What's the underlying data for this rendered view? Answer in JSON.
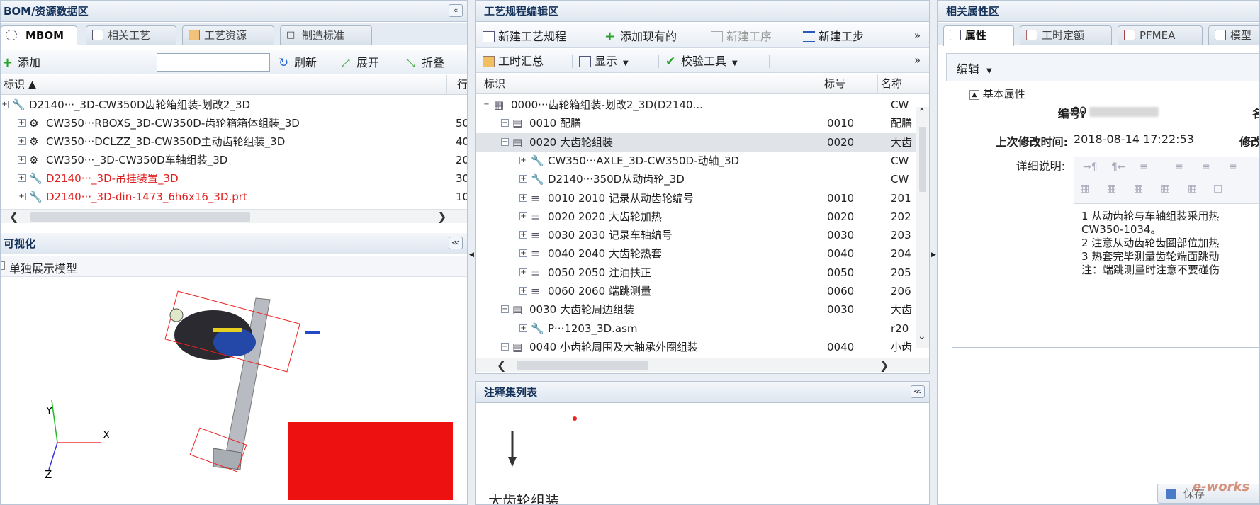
{
  "left": {
    "title": "BOM/资源数据区",
    "tabs": [
      "MBOM",
      "相关工艺",
      "工艺资源",
      "制造标准"
    ],
    "toolbar": {
      "add": "添加",
      "refresh": "刷新",
      "expand": "展开",
      "collapse": "折叠",
      "search_value": ""
    },
    "columns": [
      "标识",
      "行"
    ],
    "rows": [
      {
        "label": "D2140···_3D-CW350D齿轮箱组装-划改2_3D",
        "num": "",
        "red": false
      },
      {
        "label": "CW350···RBOXS_3D-CW350D-齿轮箱箱体组装_3D",
        "num": "50",
        "red": false
      },
      {
        "label": "CW350···DCLZZ_3D-CW350D主动齿轮组装_3D",
        "num": "40",
        "red": false
      },
      {
        "label": "CW350···_3D-CW350D车轴组装_3D",
        "num": "20",
        "red": false
      },
      {
        "label": "D2140···_3D-吊挂装置_3D",
        "num": "30",
        "red": true
      },
      {
        "label": "D2140···_3D-din-1473_6h6x16_3D.prt",
        "num": "10",
        "red": true
      }
    ],
    "viz_title": "可视化",
    "viz_checkbox": "单独展示模型",
    "axes": {
      "x": "X",
      "y": "Y",
      "z": "Z"
    }
  },
  "middle": {
    "title": "工艺规程编辑区",
    "toolbar1": {
      "new_plan": "新建工艺规程",
      "add_existing": "添加现有的",
      "new_op": "新建工序",
      "new_step": "新建工步"
    },
    "toolbar2": {
      "time_sum": "工时汇总",
      "display": "显示",
      "check_tool": "校验工具"
    },
    "columns": [
      "标识",
      "标号",
      "名称"
    ],
    "rows": [
      {
        "label": "0000···齿轮箱组装-划改2_3D(D2140...",
        "num": "",
        "name": "CW",
        "level": 0,
        "type": "root"
      },
      {
        "label": "0010 配膳",
        "num": "0010",
        "name": "配膳",
        "level": 1,
        "type": "op"
      },
      {
        "label": "0020 大齿轮组装",
        "num": "0020",
        "name": "大齿",
        "level": 1,
        "type": "op",
        "selected": true
      },
      {
        "label": "CW350···AXLE_3D-CW350D-动轴_3D",
        "num": "",
        "name": "CW",
        "level": 2,
        "type": "part"
      },
      {
        "label": "D2140···350D从动齿轮_3D",
        "num": "",
        "name": "CW",
        "level": 2,
        "type": "part"
      },
      {
        "label": "0010 2010 记录从动齿轮编号",
        "num": "0010",
        "name": "201",
        "level": 2,
        "type": "step"
      },
      {
        "label": "0020 2020 大齿轮加热",
        "num": "0020",
        "name": "202",
        "level": 2,
        "type": "step"
      },
      {
        "label": "0030 2030 记录车轴编号",
        "num": "0030",
        "name": "203",
        "level": 2,
        "type": "step"
      },
      {
        "label": "0040 2040 大齿轮热套",
        "num": "0040",
        "name": "204",
        "level": 2,
        "type": "step"
      },
      {
        "label": "0050 2050 注油扶正",
        "num": "0050",
        "name": "205",
        "level": 2,
        "type": "step"
      },
      {
        "label": "0060 2060 端跳测量",
        "num": "0060",
        "name": "206",
        "level": 2,
        "type": "step"
      },
      {
        "label": "0030 大齿轮周边组装",
        "num": "0030",
        "name": "大齿",
        "level": 1,
        "type": "op"
      },
      {
        "label": "P···1203_3D.asm",
        "num": "",
        "name": "r20",
        "level": 2,
        "type": "part"
      },
      {
        "label": "0040 小齿轮周围及大轴承外圈组装",
        "num": "0040",
        "name": "小齿",
        "level": 1,
        "type": "op"
      }
    ],
    "notes_title": "注释集列表",
    "notes_caption": "大齿轮组装"
  },
  "right": {
    "title": "相关属性区",
    "tabs": [
      "属性",
      "工时定额",
      "PFMEA",
      "模型"
    ],
    "edit_button": "编辑",
    "section": "基本属性",
    "fields": {
      "code_label": "编号:",
      "code_value": "00",
      "name_label": "名",
      "modified_label": "上次修改时间:",
      "modified_value": "2018-08-14 17:22:53",
      "modifier_label": "修改",
      "detail_label": "详细说明:"
    },
    "detail_lines": [
      "1 从动齿轮与车轴组装采用热",
      "CW350-1034。",
      "2 注意从动齿轮齿圈部位加热",
      "3 热套完毕测量齿轮端面跳动",
      "注：端跳测量时注意不要碰伤"
    ],
    "save_button": "保存",
    "watermark": "e-works"
  }
}
